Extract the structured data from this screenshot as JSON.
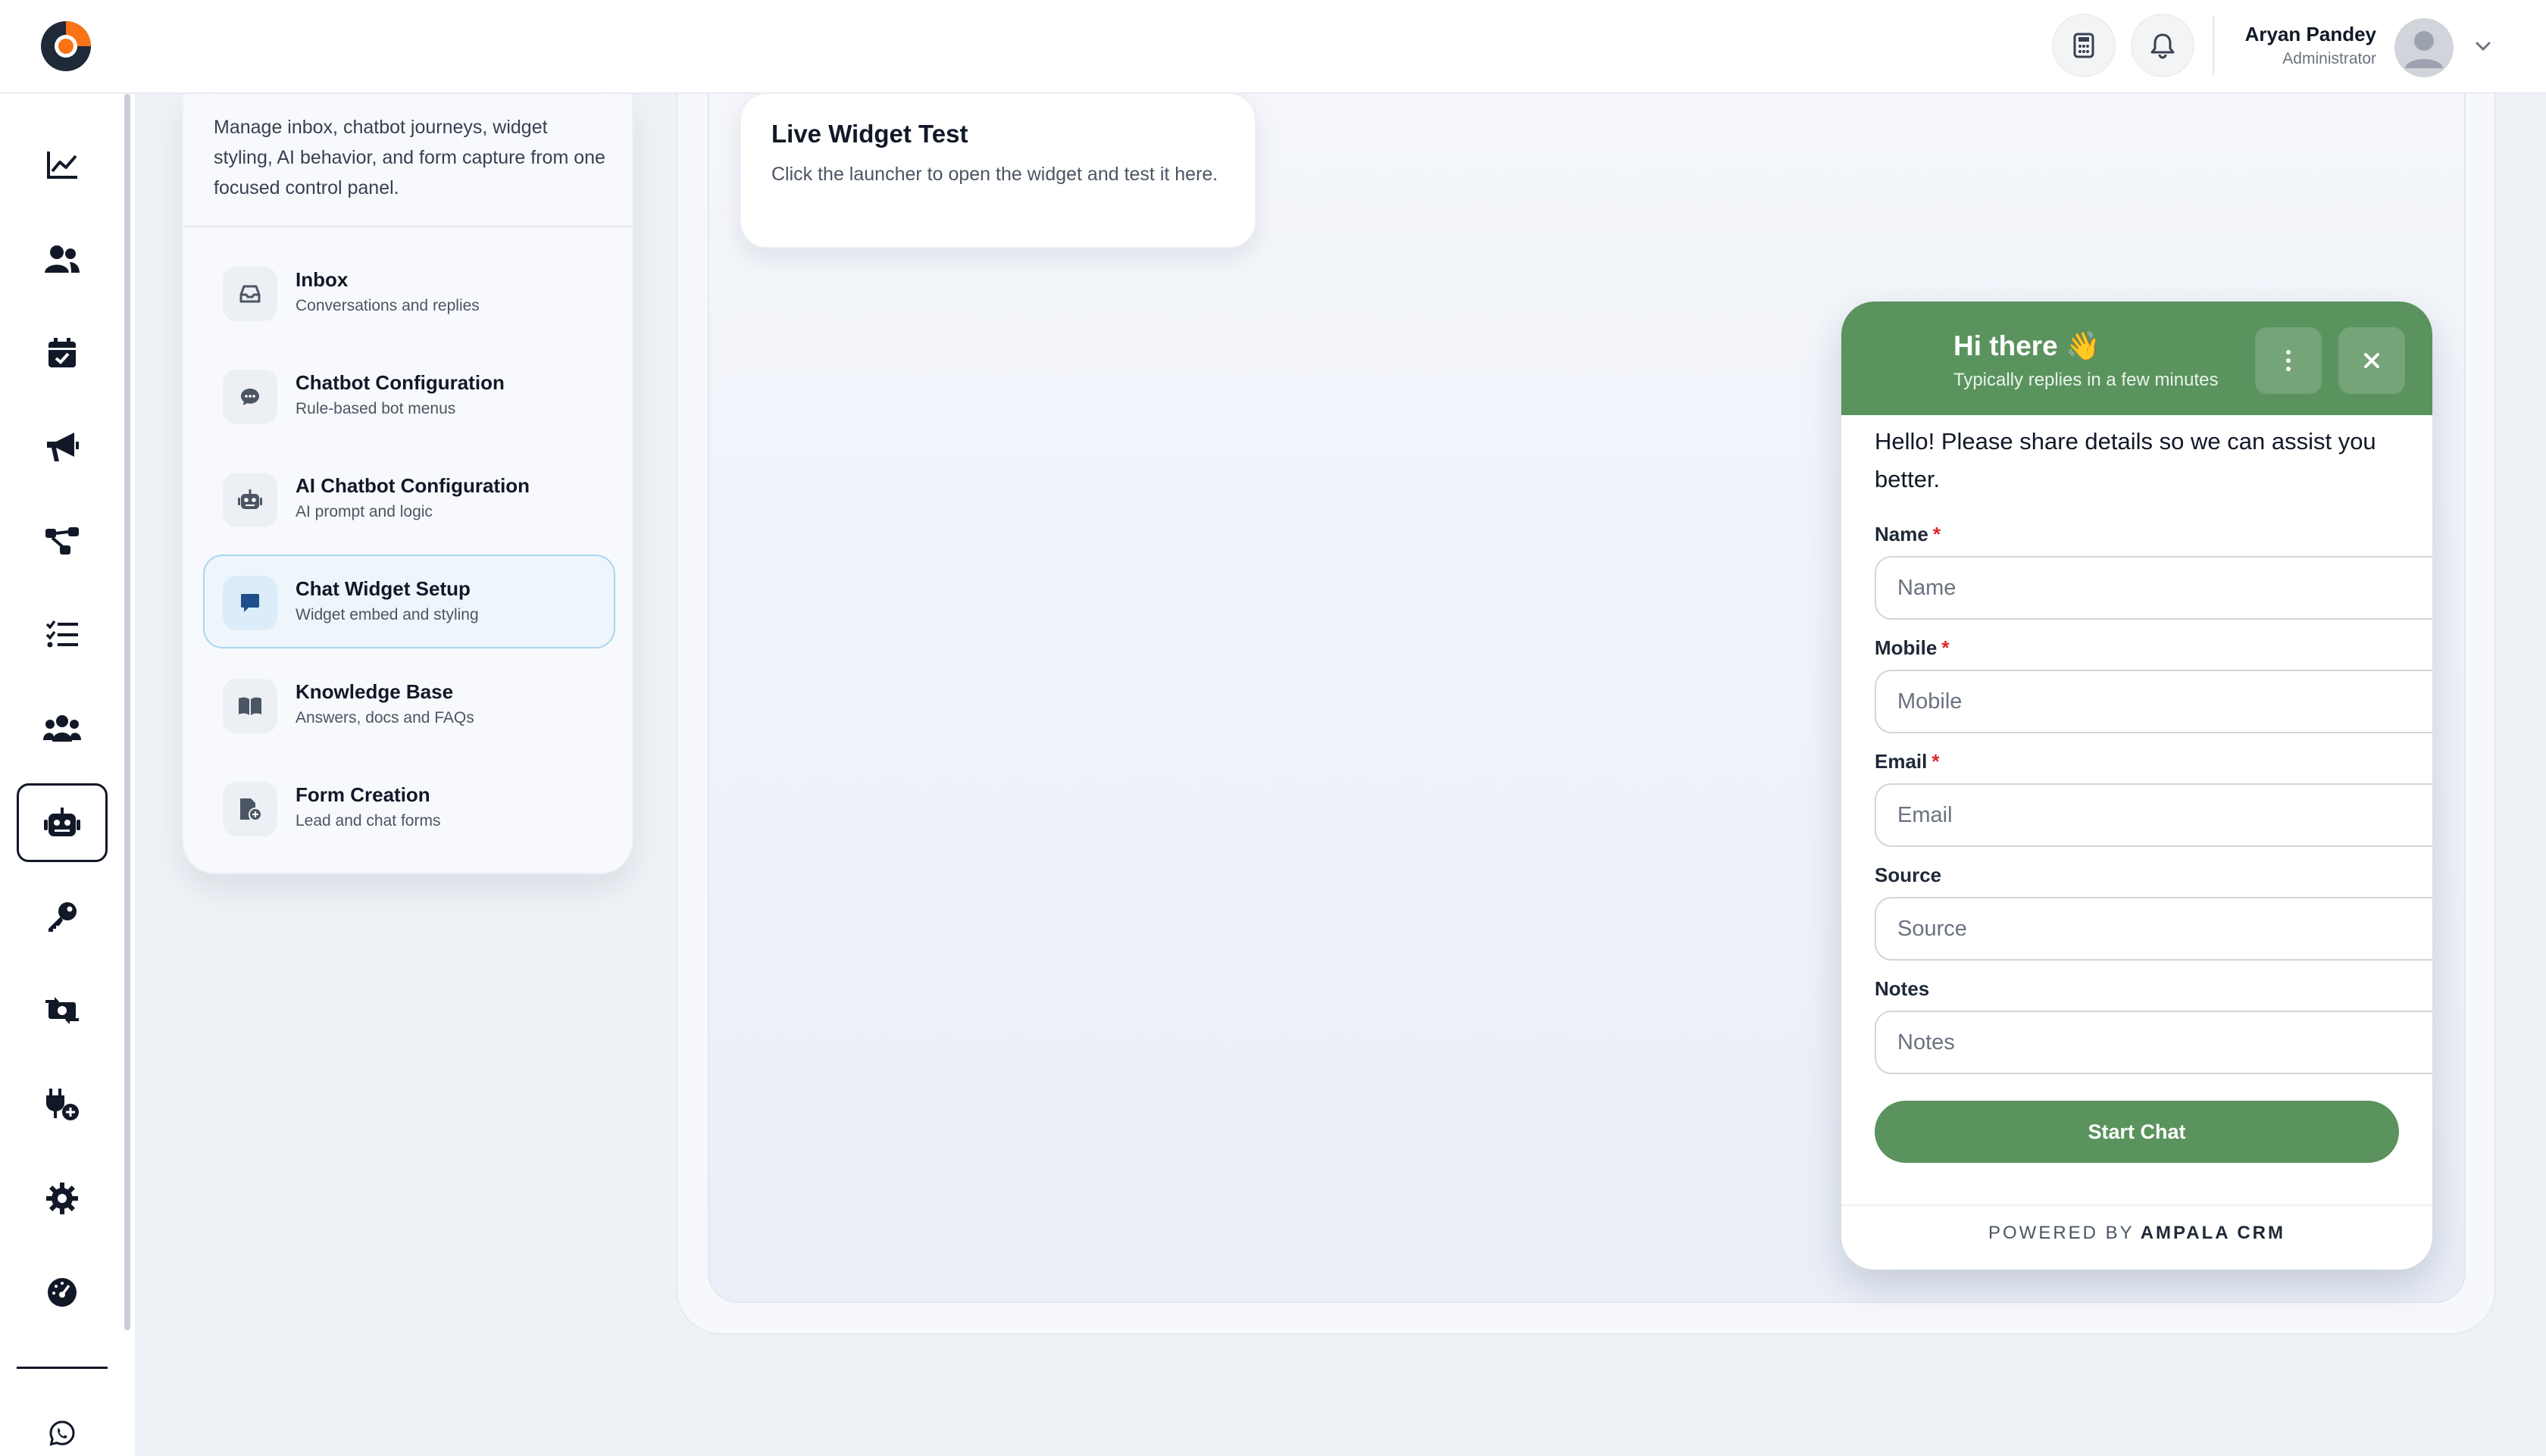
{
  "topbar": {
    "user_name": "Aryan Pandey",
    "user_role": "Administrator",
    "icons": [
      "calculator-icon",
      "bell-icon",
      "chevron-down-icon"
    ],
    "brand_colors": {
      "ring": "#1f2937",
      "accent": "#f97316"
    }
  },
  "rail": {
    "items": [
      "chart-line-icon",
      "users-icon",
      "calendar-check-icon",
      "megaphone-icon",
      "workflow-icon",
      "tasks-icon",
      "team-icon",
      "robot-icon",
      "key-icon",
      "money-exchange-icon",
      "plug-icon",
      "gear-icon",
      "dashboard-gauge-icon",
      "whatsapp-icon"
    ],
    "active": "robot-icon"
  },
  "panel": {
    "description": "Manage inbox, chatbot journeys, widget styling, AI behavior, and form capture from one focused control panel.",
    "items": [
      {
        "title": "Inbox",
        "subtitle": "Conversations and replies",
        "icon": "inbox-icon"
      },
      {
        "title": "Chatbot Configuration",
        "subtitle": "Rule-based bot menus",
        "icon": "chat-bubble-icon"
      },
      {
        "title": "AI Chatbot Configuration",
        "subtitle": "AI prompt and logic",
        "icon": "robot-icon"
      },
      {
        "title": "Chat Widget Setup",
        "subtitle": "Widget embed and styling",
        "icon": "message-square-icon",
        "active": true
      },
      {
        "title": "Knowledge Base",
        "subtitle": "Answers, docs and FAQs",
        "icon": "book-icon"
      },
      {
        "title": "Form Creation",
        "subtitle": "Lead and chat forms",
        "icon": "file-plus-icon"
      }
    ]
  },
  "live_test": {
    "title": "Live Widget Test",
    "description": "Click the launcher to open the widget and test it here."
  },
  "widget": {
    "greeting": "Hi there 👋",
    "reply_time": "Typically replies in a few minutes",
    "intro": "Hello! Please share details so we can assist you better.",
    "header_color": "#5a935d",
    "fields": [
      {
        "label": "Name",
        "placeholder": "Name",
        "required": "*"
      },
      {
        "label": "Mobile",
        "placeholder": "Mobile",
        "required": "*"
      },
      {
        "label": "Email",
        "placeholder": "Email",
        "required": "*"
      },
      {
        "label": "Source",
        "placeholder": "Source",
        "required": ""
      },
      {
        "label": "Notes",
        "placeholder": "Notes",
        "required": ""
      }
    ],
    "submit_label": "Start Chat",
    "powered_by": "POWERED BY",
    "brand": "AMPALA CRM"
  }
}
